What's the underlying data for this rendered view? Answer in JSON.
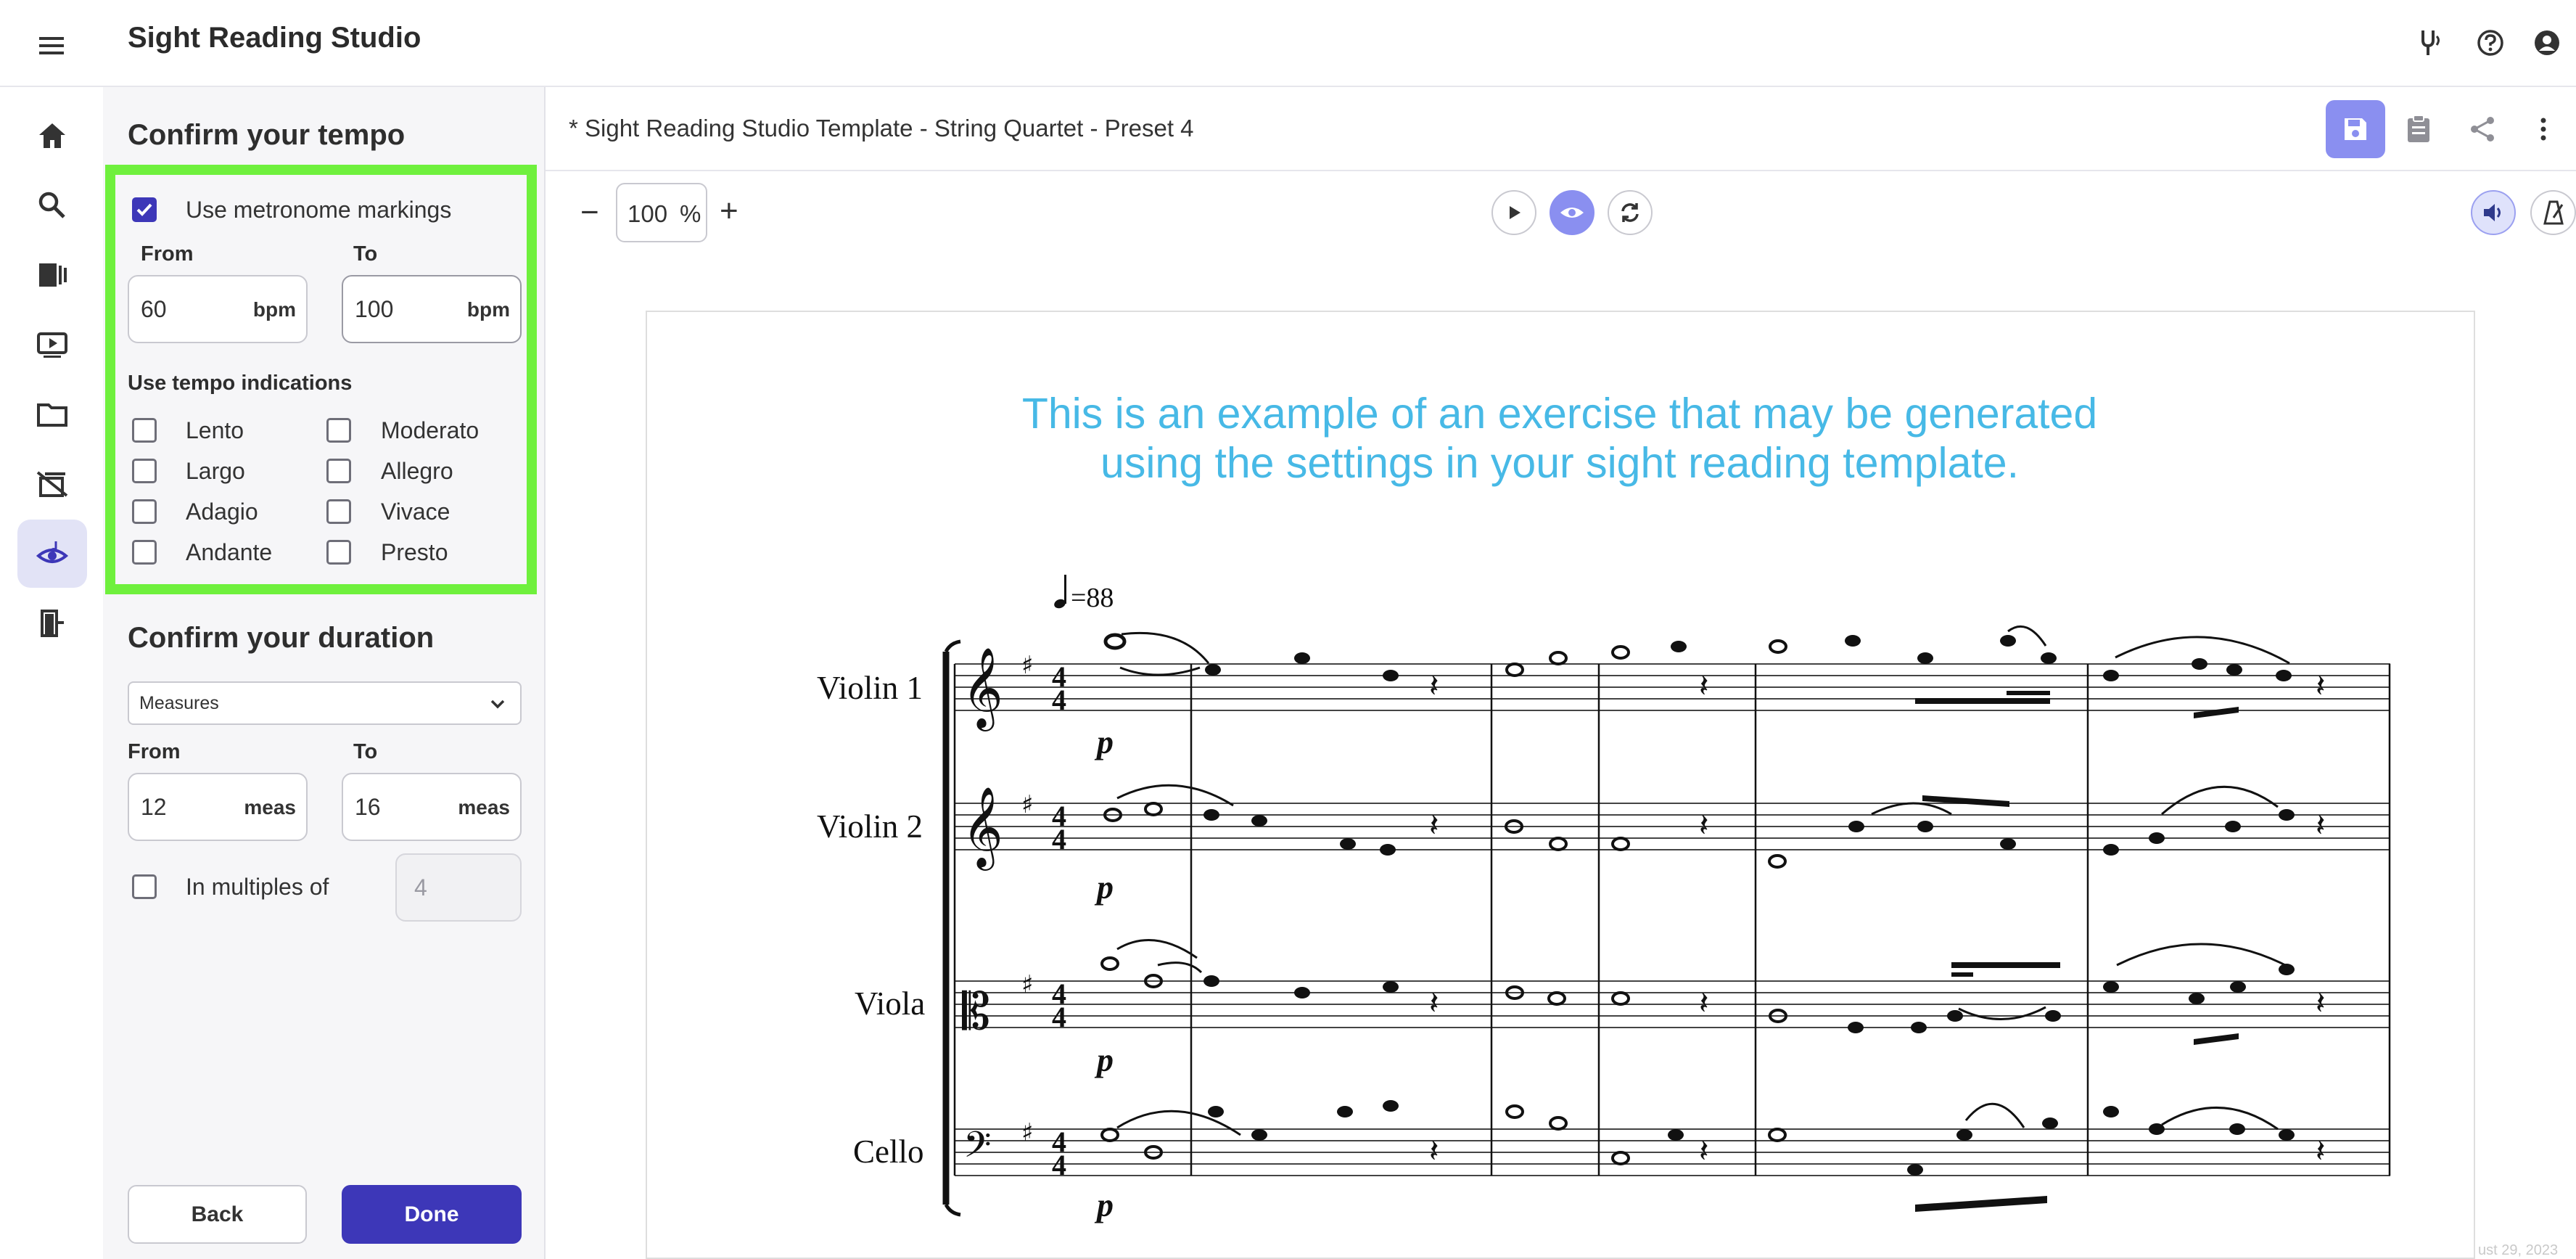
{
  "app": {
    "title": "Sight Reading Studio"
  },
  "topbar_icons": [
    "tuning-fork-icon",
    "help-icon",
    "account-icon"
  ],
  "rail_icons": [
    "menu-icon",
    "home-icon",
    "search-icon",
    "library-icon",
    "video-icon",
    "folder-icon",
    "assignments-icon",
    "sight-reading-icon",
    "exit-icon"
  ],
  "tempo": {
    "heading": "Confirm your tempo",
    "use_metronome_label": "Use metronome markings",
    "use_metronome_checked": true,
    "from_label": "From",
    "to_label": "To",
    "from_value": "60",
    "to_value": "100",
    "unit": "bpm",
    "indications_heading": "Use tempo indications",
    "indications_left": [
      "Lento",
      "Largo",
      "Adagio",
      "Andante"
    ],
    "indications_right": [
      "Moderato",
      "Allegro",
      "Vivace",
      "Presto"
    ]
  },
  "duration": {
    "heading": "Confirm your duration",
    "select_value": "Measures",
    "from_label": "From",
    "to_label": "To",
    "from_value": "12",
    "to_value": "16",
    "unit": "meas",
    "multiples_label": "In multiples of",
    "multiples_value": "4"
  },
  "buttons": {
    "back": "Back",
    "done": "Done"
  },
  "document": {
    "title": "* Sight Reading Studio Template - String Quartet - Preset 4",
    "zoom_value": "100",
    "zoom_unit": "%",
    "zoom_minus": "−",
    "zoom_plus": "+"
  },
  "sheet": {
    "example_text_line1": "This is an example of an exercise that may be generated",
    "example_text_line2": "using the settings in your sight reading template.",
    "tempo_marking": "=88",
    "instruments": [
      "Violin 1",
      "Violin 2",
      "Viola",
      "Cello"
    ],
    "dynamic": "p",
    "time_signature": [
      "4",
      "4"
    ],
    "footer_text": "ust 29, 2023"
  },
  "colors": {
    "accent": "#3d37b8",
    "highlight": "#6ff03d",
    "example_text": "#47b9e6",
    "active_rail": "#e2e3f6"
  }
}
